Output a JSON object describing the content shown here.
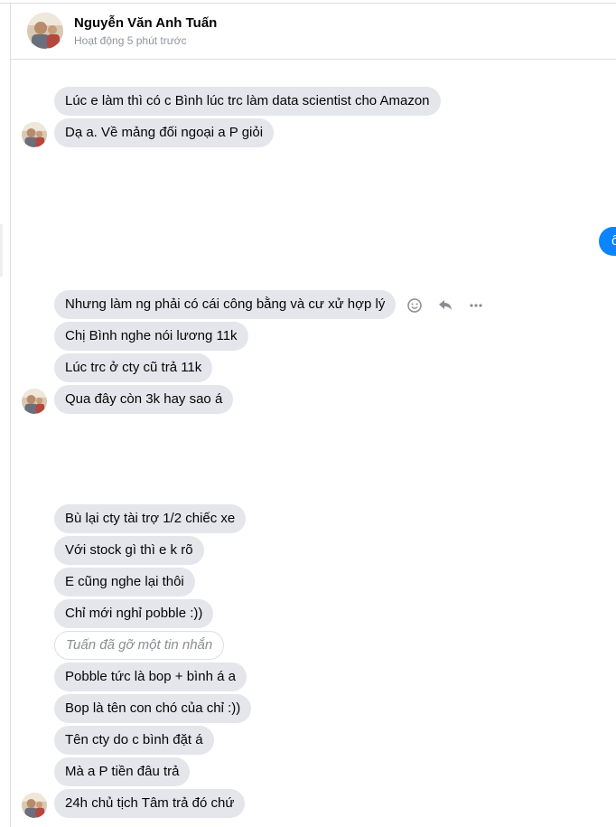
{
  "header": {
    "contact_name": "Nguyễn Văn Anh Tuấn",
    "status": "Hoạt động 5 phút trước"
  },
  "outgoing": {
    "visible_text": "ổ"
  },
  "messages": [
    {
      "text": "Lúc e làm thì có c Bình lúc trc làm data scientist cho Amazon"
    },
    {
      "text": "Dạ a. Về mảng đối ngoại a P giỏi"
    },
    {
      "text": "Nhưng làm ng phải có cái công bằng và cư xử hợp lý"
    },
    {
      "text": "Chị Bình nghe nói lương 11k"
    },
    {
      "text": "Lúc trc ở cty cũ trả 11k"
    },
    {
      "text": "Qua đây còn 3k hay sao á"
    },
    {
      "text": "Bù lại cty tài trợ 1/2 chiếc xe"
    },
    {
      "text": "Với stock gì thì e k rõ"
    },
    {
      "text": "E cũng nghe lại thôi"
    },
    {
      "text": "Chỉ mới nghỉ pobble :))"
    },
    {
      "text": "Tuấn đã gỡ một tin nhắn"
    },
    {
      "text": "Pobble tức là bop + bình á a"
    },
    {
      "text": "Bop là tên con chó của chỉ :))"
    },
    {
      "text": "Tên cty do c bình đặt á"
    },
    {
      "text": "Mà a P tiền đâu trả"
    },
    {
      "text": "24h chủ tịch Tâm trả đó chứ"
    }
  ],
  "hover_actions": [
    "smiley-icon",
    "reply-icon",
    "more-icon"
  ],
  "colors": {
    "incoming_bubble": "#e4e6eb",
    "outgoing_bubble": "#0a84ff",
    "secondary_text": "#90949c",
    "action_icon": "#8a8d91"
  }
}
